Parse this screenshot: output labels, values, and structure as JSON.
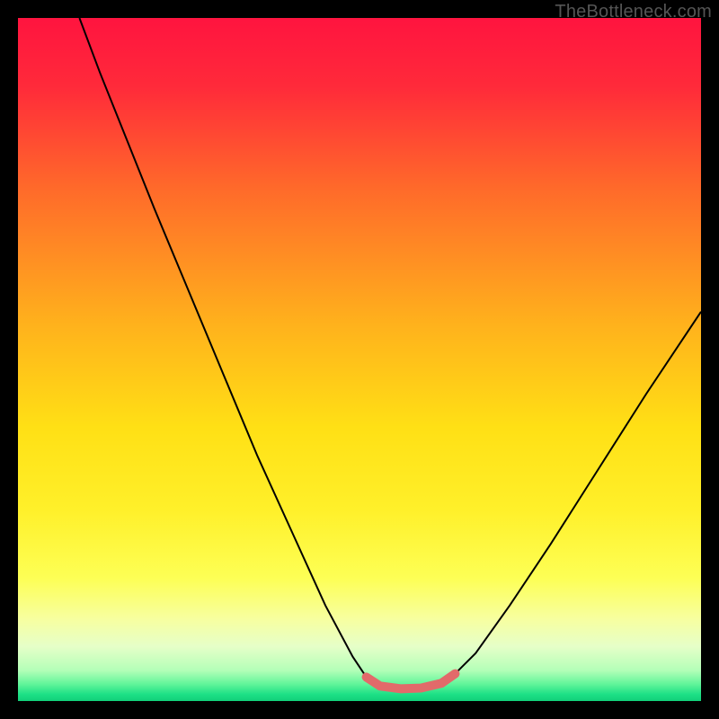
{
  "watermark": "TheBottleneck.com",
  "chart_data": {
    "type": "line",
    "title": "",
    "xlabel": "",
    "ylabel": "",
    "xlim": [
      0,
      100
    ],
    "ylim": [
      0,
      100
    ],
    "grid": false,
    "legend": false,
    "gradient_stops": [
      {
        "pos": 0.0,
        "color": "#ff143f"
      },
      {
        "pos": 0.1,
        "color": "#ff2a3a"
      },
      {
        "pos": 0.25,
        "color": "#ff6a2a"
      },
      {
        "pos": 0.45,
        "color": "#ffb21c"
      },
      {
        "pos": 0.6,
        "color": "#ffe015"
      },
      {
        "pos": 0.72,
        "color": "#fff02a"
      },
      {
        "pos": 0.82,
        "color": "#fdff55"
      },
      {
        "pos": 0.88,
        "color": "#f7ffa0"
      },
      {
        "pos": 0.92,
        "color": "#e6ffc8"
      },
      {
        "pos": 0.955,
        "color": "#b4ffb8"
      },
      {
        "pos": 0.975,
        "color": "#62f59a"
      },
      {
        "pos": 0.99,
        "color": "#1ee086"
      },
      {
        "pos": 1.0,
        "color": "#11d07a"
      }
    ],
    "series": [
      {
        "name": "bottleneck-curve",
        "stroke": "#000000",
        "stroke_width": 2,
        "points": [
          {
            "x": 9.0,
            "y": 100.0
          },
          {
            "x": 12.0,
            "y": 92.0
          },
          {
            "x": 16.0,
            "y": 82.0
          },
          {
            "x": 20.0,
            "y": 72.0
          },
          {
            "x": 25.0,
            "y": 60.0
          },
          {
            "x": 30.0,
            "y": 48.0
          },
          {
            "x": 35.0,
            "y": 36.0
          },
          {
            "x": 40.0,
            "y": 25.0
          },
          {
            "x": 45.0,
            "y": 14.0
          },
          {
            "x": 49.0,
            "y": 6.5
          },
          {
            "x": 51.0,
            "y": 3.5
          },
          {
            "x": 53.0,
            "y": 2.2
          },
          {
            "x": 56.0,
            "y": 1.8
          },
          {
            "x": 59.0,
            "y": 1.9
          },
          {
            "x": 62.0,
            "y": 2.6
          },
          {
            "x": 64.0,
            "y": 4.0
          },
          {
            "x": 67.0,
            "y": 7.0
          },
          {
            "x": 72.0,
            "y": 14.0
          },
          {
            "x": 78.0,
            "y": 23.0
          },
          {
            "x": 85.0,
            "y": 34.0
          },
          {
            "x": 92.0,
            "y": 45.0
          },
          {
            "x": 100.0,
            "y": 57.0
          }
        ]
      },
      {
        "name": "optimal-band",
        "stroke": "#e26a6a",
        "stroke_width": 10,
        "linecap": "round",
        "points": [
          {
            "x": 51.0,
            "y": 3.5
          },
          {
            "x": 53.0,
            "y": 2.2
          },
          {
            "x": 56.0,
            "y": 1.8
          },
          {
            "x": 59.0,
            "y": 1.9
          },
          {
            "x": 62.0,
            "y": 2.6
          },
          {
            "x": 64.0,
            "y": 4.0
          }
        ]
      }
    ]
  }
}
